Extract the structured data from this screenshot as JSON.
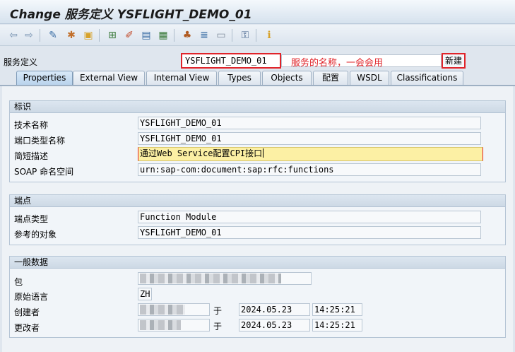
{
  "window": {
    "title": "Change 服务定义 YSFLIGHT_DEMO_01"
  },
  "toolbar": {
    "icons": [
      "back-arrow-icon",
      "forward-arrow-icon",
      "display-change-icon",
      "activate-icon",
      "other-object-icon",
      "hierarchy-icon",
      "where-used-icon",
      "transport-icon",
      "check-icon",
      "tree-icon",
      "stack-icon",
      "layout-icon",
      "lock-icon",
      "info-icon"
    ]
  },
  "header": {
    "label": "服务定义",
    "service_name": "YSFLIGHT_DEMO_01",
    "annotation": "服务的名称，一会会用",
    "new_button": "新建"
  },
  "tabs": [
    {
      "label": "Properties",
      "active": true
    },
    {
      "label": "External View"
    },
    {
      "label": "Internal View"
    },
    {
      "label": "Types"
    },
    {
      "label": "Objects"
    },
    {
      "label": "配置"
    },
    {
      "label": "WSDL"
    },
    {
      "label": "Classifications"
    }
  ],
  "groups": {
    "identification": {
      "title": "标识",
      "fields": [
        {
          "label": "技术名称",
          "value": "YSFLIGHT_DEMO_01"
        },
        {
          "label": "端口类型名称",
          "value": "YSFLIGHT_DEMO_01"
        },
        {
          "label": "简短描述",
          "value": "通过Web Service配置CPI接口"
        },
        {
          "label": "SOAP 命名空间",
          "value": "urn:sap-com:document:sap:rfc:functions"
        }
      ]
    },
    "endpoint": {
      "title": "端点",
      "fields": [
        {
          "label": "端点类型",
          "value": "Function Module"
        },
        {
          "label": "参考的对象",
          "value": "YSFLIGHT_DEMO_01"
        }
      ]
    },
    "general": {
      "title": "一般数据",
      "package_label": "包",
      "language_label": "原始语言",
      "language_value": "ZH",
      "created_label": "创建者",
      "changed_label": "更改者",
      "at_label": "于",
      "created_date": "2024.05.23",
      "created_time": "14:25:21",
      "changed_date": "2024.05.23",
      "changed_time": "14:25:21"
    }
  },
  "colors": {
    "highlight": "#e0242a",
    "edit_field": "#fcf0a4",
    "active_tab": "#b9d3ec"
  }
}
